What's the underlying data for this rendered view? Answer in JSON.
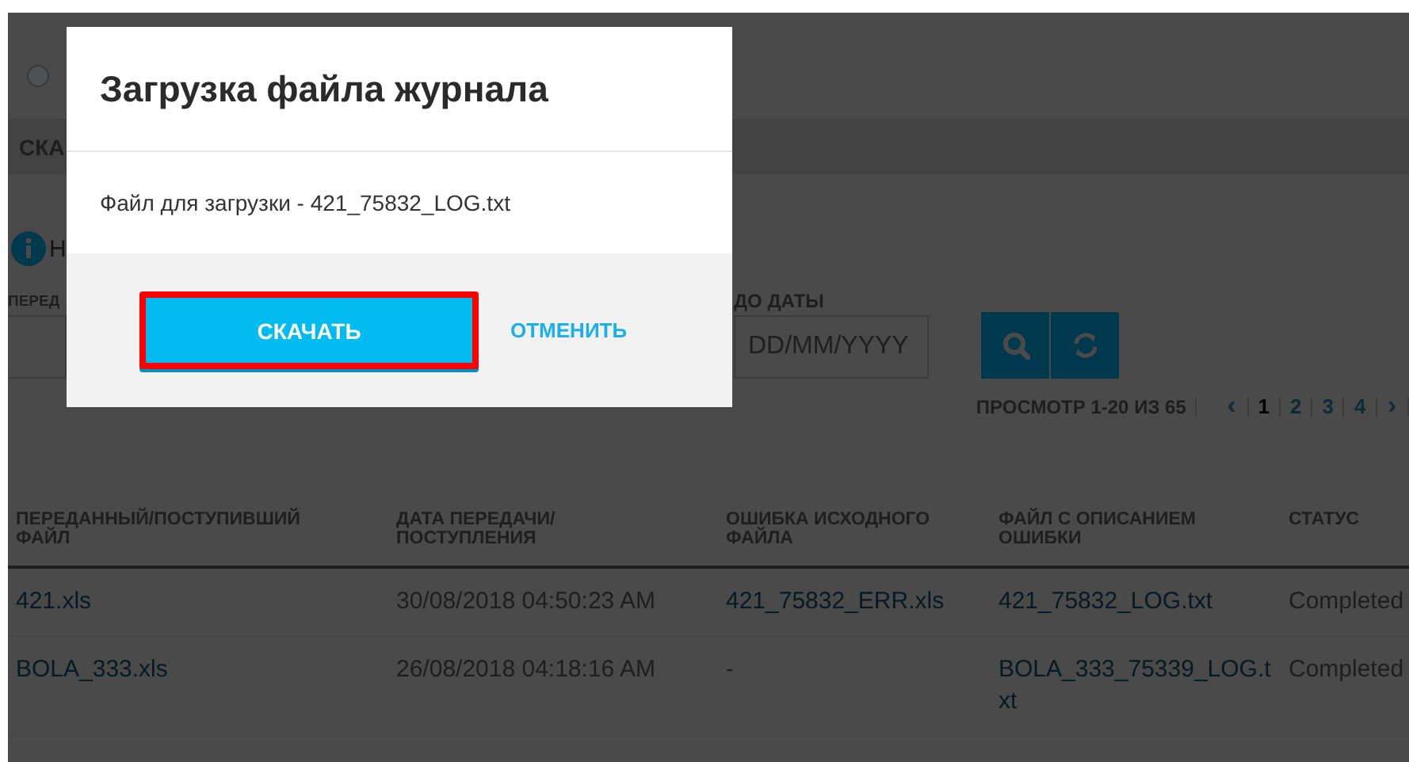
{
  "page": {
    "radio": {
      "selected": false
    },
    "tab_label": "СКА",
    "info_text": "Н",
    "from_label": "ПЕРЕД",
    "to_date": {
      "label": "ДО ДАТЫ",
      "placeholder": "DD/MM/YYYY"
    }
  },
  "pager": {
    "summary": "ПРОСМОТР 1-20 ИЗ 65",
    "prev": "‹",
    "next": "›",
    "pages": [
      {
        "label": "1",
        "selected": true
      },
      {
        "label": "2",
        "selected": false
      },
      {
        "label": "3",
        "selected": false
      },
      {
        "label": "4",
        "selected": false
      }
    ]
  },
  "table": {
    "columns": [
      "ПЕРЕДАННЫЙ/ПОСТУПИВШИЙ ФАЙЛ",
      "ДАТА ПЕРЕДАЧИ/ПОСТУПЛЕНИЯ",
      "ОШИБКА ИСХОДНОГО ФАЙЛА",
      "ФАЙЛ С ОПИСАНИЕМ ОШИБКИ",
      "СТАТУС"
    ],
    "rows": [
      {
        "cells": [
          {
            "text": "421.xls",
            "kind": "link"
          },
          {
            "text": "30/08/2018 04:50:23 AM",
            "kind": "text"
          },
          {
            "text": "421_75832_ERR.xls",
            "kind": "link"
          },
          {
            "text": "421_75832_LOG.txt",
            "kind": "link"
          },
          {
            "text": "Completed",
            "kind": "text"
          }
        ]
      },
      {
        "cells": [
          {
            "text": "BOLA_333.xls",
            "kind": "link"
          },
          {
            "text": "26/08/2018 04:18:16 AM",
            "kind": "text"
          },
          {
            "text": "-",
            "kind": "text"
          },
          {
            "text": "BOLA_333_75339_LOG.txt",
            "kind": "link"
          },
          {
            "text": "Completed",
            "kind": "text"
          }
        ]
      }
    ]
  },
  "dialog": {
    "title": "Загрузка файла журнала",
    "message": "Файл для загрузки - 421_75832_LOG.txt",
    "buttons": [
      {
        "label": "СКАЧАТЬ",
        "kind": "primary",
        "highlighted": true
      },
      {
        "label": "ОТМЕНИТЬ",
        "kind": "link",
        "highlighted": false
      }
    ]
  }
}
